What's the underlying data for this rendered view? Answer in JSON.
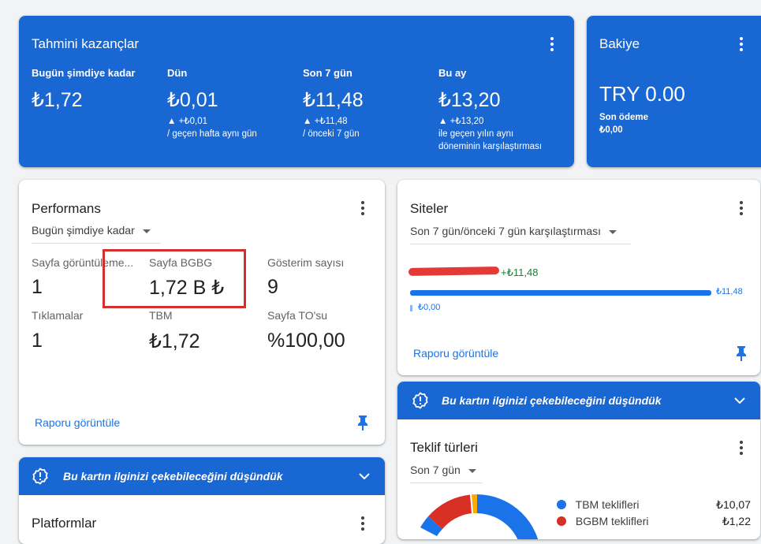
{
  "earnings": {
    "title": "Tahmini kazançlar",
    "cols": [
      {
        "label": "Bugün şimdiye kadar",
        "value": "₺1,72",
        "delta": "",
        "note1": "",
        "note2": ""
      },
      {
        "label": "Dün",
        "value": "₺0,01",
        "delta": "▲ +₺0,01",
        "note1": "/ geçen hafta aynı gün",
        "note2": ""
      },
      {
        "label": "Son 7 gün",
        "value": "₺11,48",
        "delta": "▲ +₺11,48",
        "note1": "/ önceki 7 gün",
        "note2": ""
      },
      {
        "label": "Bu ay",
        "value": "₺13,20",
        "delta": "▲ +₺13,20",
        "note1": "ile geçen yılın aynı",
        "note2": "döneminin karşılaştırması"
      }
    ]
  },
  "balance": {
    "title": "Bakiye",
    "value": "TRY 0.00",
    "last_payment_label": "Son ödeme",
    "last_payment_value": "₺0,00"
  },
  "performance": {
    "title": "Performans",
    "range": "Bugün şimdiye kadar",
    "metrics": [
      {
        "label": "Sayfa görüntüleme...",
        "value": "1"
      },
      {
        "label": "Sayfa BGBG",
        "value": "1,72 B ₺"
      },
      {
        "label": "Gösterim sayısı",
        "value": "9"
      },
      {
        "label": "Tıklamalar",
        "value": "1"
      },
      {
        "label": "TBM",
        "value": "₺1,72"
      },
      {
        "label": "Sayfa TO'su",
        "value": "%100,00"
      }
    ],
    "report_link": "Raporu görüntüle"
  },
  "sites": {
    "title": "Siteler",
    "range": "Son 7 gün/önceki 7 gün karşılaştırması",
    "site_delta": "+₺11,48",
    "bar_current": "₺11,48",
    "bar_previous": "₺0,00",
    "bar_fraction": 1.0,
    "report_link": "Raporu görüntüle"
  },
  "suggestion_banner_left": {
    "text": "Bu kartın ilginizi çekebileceğini düşündük"
  },
  "suggestion_banner_right": {
    "text": "Bu kartın ilginizi çekebileceğini düşündük"
  },
  "platforms": {
    "title": "Platformlar"
  },
  "bid_types": {
    "title": "Teklif türleri",
    "range": "Son 7 gün",
    "legend": [
      {
        "label": "TBM teklifleri",
        "value": "₺10,07",
        "color": "#1a73e8"
      },
      {
        "label": "BGBM teklifleri",
        "value": "₺1,22",
        "color": "#d93025"
      }
    ]
  },
  "colors": {
    "accent": "#1967d2",
    "link": "#1a73e8",
    "highlight": "#d32f2f",
    "positive": "#188038"
  }
}
